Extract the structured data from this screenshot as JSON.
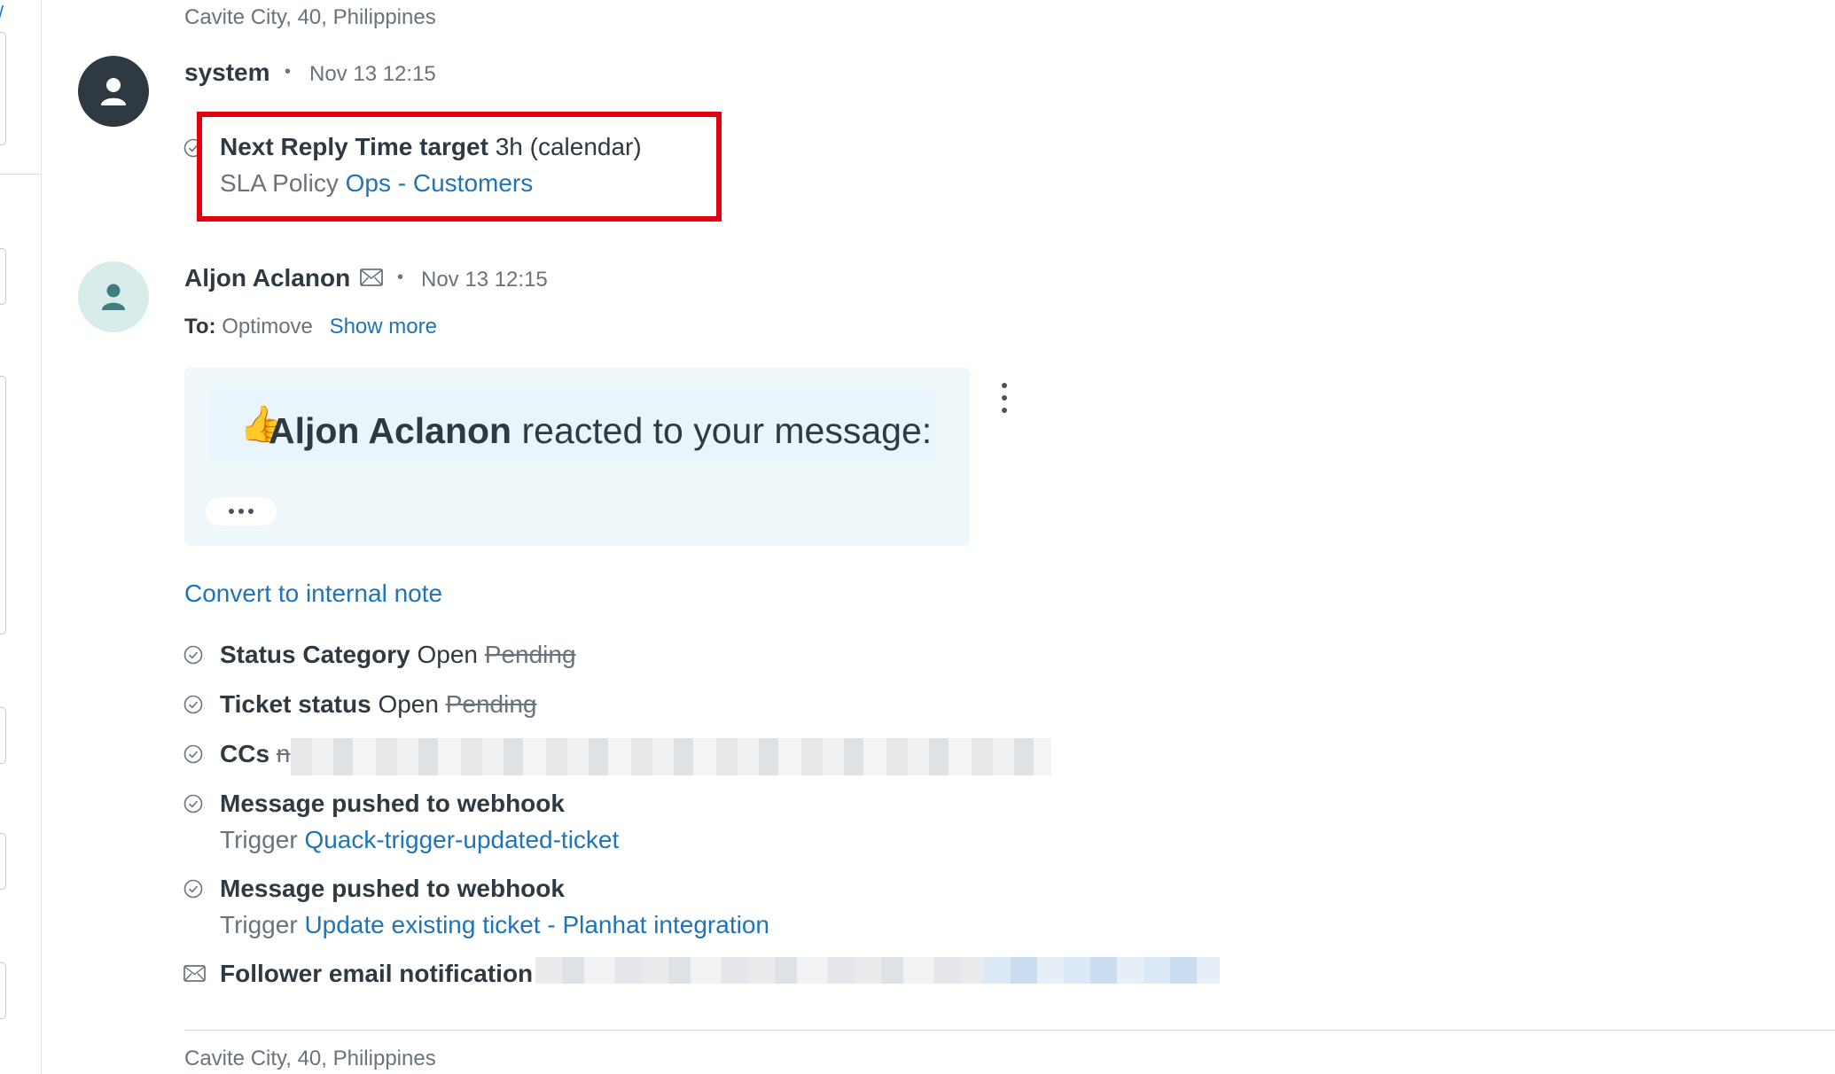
{
  "top_location": "Cavite City, 40, Philippines",
  "system_event": {
    "author": "system",
    "separator": "•",
    "timestamp": "Nov 13 12:15",
    "sla_title": "Next Reply Time target",
    "sla_value": "3h (calendar)",
    "policy_label": "SLA Policy",
    "policy_link": "Ops - Customers"
  },
  "message": {
    "author": "Aljon Aclanon",
    "separator": "•",
    "timestamp": "Nov 13 12:15",
    "to_label": "To:",
    "to_value": "Optimove",
    "show_more": "Show more",
    "reaction_emoji": "👍",
    "reaction_name": "Aljon Aclanon",
    "reaction_text": "reacted to your message:",
    "convert_link": "Convert to internal note"
  },
  "events": [
    {
      "title": "Status Category",
      "value": "Open",
      "old": "Pending"
    },
    {
      "title": "Ticket status",
      "value": "Open",
      "old": "Pending"
    },
    {
      "title": "CCs",
      "old": "n"
    },
    {
      "title": "Message pushed to webhook",
      "sub_label": "Trigger",
      "sub_link": "Quack-trigger-updated-ticket"
    },
    {
      "title": "Message pushed to webhook",
      "sub_label": "Trigger",
      "sub_link": "Update existing ticket - Planhat integration"
    },
    {
      "title": "Follower email notification"
    }
  ],
  "bottom_location": "Cavite City, 40, Philippines",
  "colors": {
    "link": "#1f73b7",
    "highlight": "#e3000f",
    "card": "#eef7fa"
  }
}
